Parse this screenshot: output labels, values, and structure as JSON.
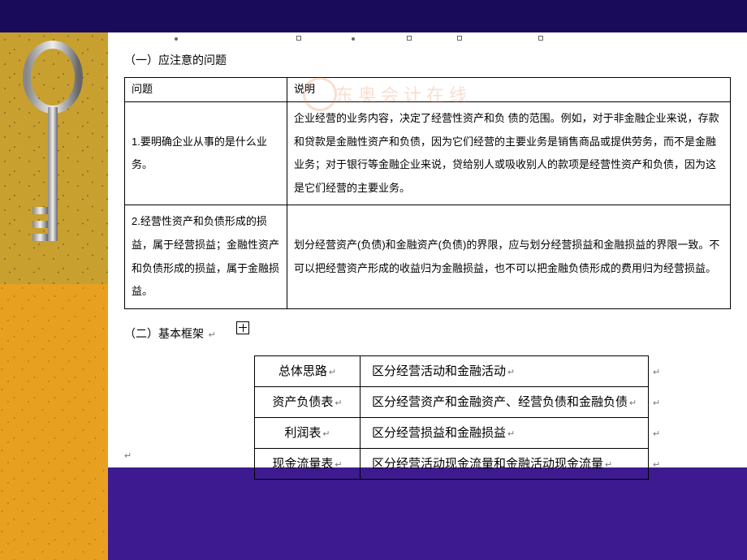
{
  "section1": {
    "title": "（一）应注意的问题",
    "headers": [
      "问题",
      "说明"
    ],
    "rows": [
      {
        "q": "1.要明确企业从事的是什么业务。",
        "a": "企业经营的业务内容，决定了经营性资产和负 债的范围。例如，对于非金融企业来说，存款和贷款是金融性资产和负债，因为它们经营的主要业务是销售商品或提供劳务，而不是金融业务；对于银行等金融企业来说，贷给别人或吸收别人的款项是经营性资产和负债，因为这是它们经营的主要业务。"
      },
      {
        "q": "2.经营性资产和负债形成的损益，属于经营损益；金融性资产和负债形成的损益，属于金融损益。",
        "a": "划分经营资产(负债)和金融资产(负债)的界限，应与划分经营损益和金融损益的界限一致。不可以把经营资产形成的收益归为金融损益，也不可以把金融负债形成的费用归为经营损益。"
      }
    ]
  },
  "section2": {
    "title": "（二）基本框架",
    "rows": [
      {
        "label": "总体思路",
        "desc": "区分经营活动和金融活动"
      },
      {
        "label": "资产负债表",
        "desc": "区分经营资产和金融资产、经营负债和金融负债"
      },
      {
        "label": "利润表",
        "desc": "区分经营损益和金融损益"
      },
      {
        "label": "现金流量表",
        "desc": "区分经营活动现金流量和金融活动现金流量"
      }
    ]
  },
  "watermark": "东奥会计在线",
  "ret_symbol": "↵"
}
